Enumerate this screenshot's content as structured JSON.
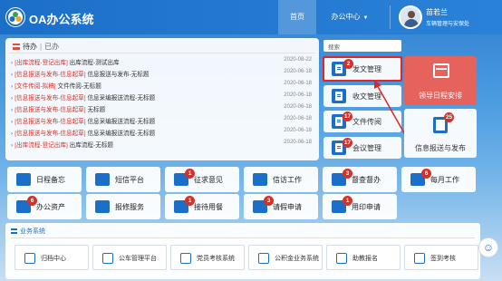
{
  "header": {
    "title": "OA办公系统",
    "nav": {
      "home": "首页",
      "office": "办公中心"
    },
    "user": {
      "name": "苗若兰",
      "dept": "车辆管理与安保处"
    }
  },
  "todo": {
    "tab_pending": "待办",
    "tab_done": "已办",
    "rows": [
      {
        "tag": "[出库流程-登记出库]",
        "text": "出库流程-测试出库",
        "date": "2020-08-22"
      },
      {
        "tag": "[信息报送与发布-信息起草]",
        "text": "信息报送与发布-无标题",
        "date": "2020-06-18"
      },
      {
        "tag": "[文件传阅-拟稿]",
        "text": "文件传阅-无标题",
        "date": "2020-06-18"
      },
      {
        "tag": "[信息报送与发布-信息起草]",
        "text": "信息采编报送流程-无标题",
        "date": "2020-06-18"
      },
      {
        "tag": "[信息报送与发布-信息起草]",
        "text": "无标题",
        "date": "2020-06-18"
      },
      {
        "tag": "[信息报送与发布-信息起草]",
        "text": "信息采编报送流程-无标题",
        "date": "2020-06-18"
      },
      {
        "tag": "[信息报送与发布-信息起草]",
        "text": "信息采编报送流程-无标题",
        "date": "2020-06-18"
      },
      {
        "tag": "[出库流程-登记出库]",
        "text": "出库流程-无标题",
        "date": "2020-06-18"
      }
    ]
  },
  "search": {
    "label": "搜索"
  },
  "docs": [
    {
      "label": "发文管理",
      "badge": "2"
    },
    {
      "label": "收文管理",
      "badge": ""
    },
    {
      "label": "文件传阅",
      "badge": "17"
    },
    {
      "label": "会议管理",
      "badge": "17"
    }
  ],
  "schedule": {
    "label": "领导日程安排"
  },
  "report": {
    "label": "信息报送与发布",
    "badge": "25"
  },
  "grid": [
    {
      "label": "日程备忘",
      "badge": ""
    },
    {
      "label": "短信平台",
      "badge": ""
    },
    {
      "label": "征求意见",
      "badge": "1"
    },
    {
      "label": "信访工作",
      "badge": ""
    },
    {
      "label": "督查督办",
      "badge": "3"
    },
    {
      "label": "每月工作",
      "badge": "6"
    },
    {
      "label": "办公资产",
      "badge": "6"
    },
    {
      "label": "报修服务",
      "badge": ""
    },
    {
      "label": "接待用餐",
      "badge": "1"
    },
    {
      "label": "请假申请",
      "badge": "3"
    },
    {
      "label": "用印申请",
      "badge": "1"
    }
  ],
  "business": {
    "title": "业务系统",
    "items": [
      "归档中心",
      "公车管理平台",
      "党员考核系统",
      "公积金业务系统",
      "助教报名",
      "签到考核"
    ]
  },
  "colors": {
    "primary": "#1c6fc8",
    "badge": "#d93025",
    "schedule": "#e6625d",
    "highlight": "#e02626"
  }
}
